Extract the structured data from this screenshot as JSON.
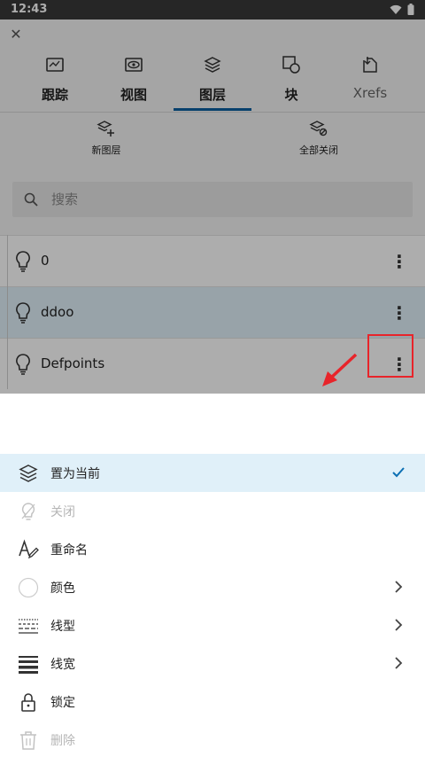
{
  "status_bar": {
    "time": "12:43"
  },
  "header": {
    "close_icon": "close-icon",
    "tabs": [
      {
        "label": "跟踪",
        "icon": "track-icon",
        "active": false
      },
      {
        "label": "视图",
        "icon": "view-icon",
        "active": false
      },
      {
        "label": "图层",
        "icon": "layers-icon",
        "active": true
      },
      {
        "label": "块",
        "icon": "block-icon",
        "active": false
      },
      {
        "label": "Xrefs",
        "icon": "xrefs-icon",
        "active": false
      }
    ],
    "accent_color": "#0b5f9f"
  },
  "toolbar": {
    "new_layer_label": "新图层",
    "close_all_label": "全部关闭"
  },
  "search": {
    "placeholder": "搜索"
  },
  "layers": [
    {
      "name": "0",
      "selected": false
    },
    {
      "name": "ddoo",
      "selected": true
    },
    {
      "name": "Defpoints",
      "selected": false
    }
  ],
  "annotation": {
    "color": "#e8242a"
  },
  "context_menu": {
    "items": [
      {
        "label": "置为当前",
        "icon": "set-current-layers-icon",
        "selected": true,
        "right": "check-icon",
        "disabled": false
      },
      {
        "label": "关闭",
        "icon": "bulb-off-icon",
        "selected": false,
        "right": "",
        "disabled": true
      },
      {
        "label": "重命名",
        "icon": "rename-icon",
        "selected": false,
        "right": "",
        "disabled": false
      },
      {
        "label": "颜色",
        "icon": "color-circle-icon",
        "selected": false,
        "right": "chevron-right-icon",
        "disabled": false
      },
      {
        "label": "线型",
        "icon": "linetype-icon",
        "selected": false,
        "right": "chevron-right-icon",
        "disabled": false
      },
      {
        "label": "线宽",
        "icon": "lineweight-icon",
        "selected": false,
        "right": "chevron-right-icon",
        "disabled": false
      },
      {
        "label": "锁定",
        "icon": "lock-icon",
        "selected": false,
        "right": "",
        "disabled": false
      },
      {
        "label": "删除",
        "icon": "trash-icon",
        "selected": false,
        "right": "",
        "disabled": true
      }
    ]
  }
}
